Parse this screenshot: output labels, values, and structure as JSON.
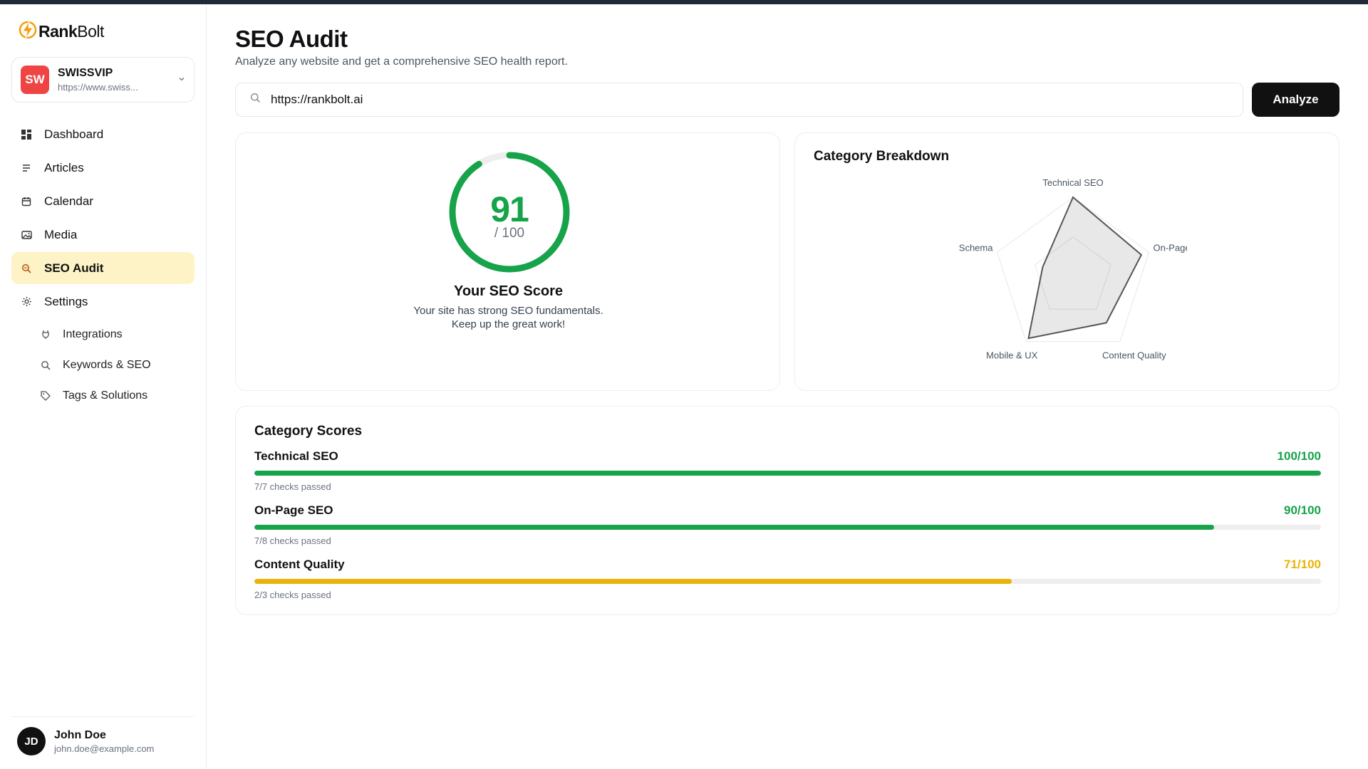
{
  "app": {
    "name_bold": "Rank",
    "name_light": "Bolt"
  },
  "workspace": {
    "initials": "SW",
    "name": "SWISSVIP",
    "url": "https://www.swiss..."
  },
  "nav": [
    {
      "label": "Dashboard",
      "icon": "dashboard-icon",
      "active": false
    },
    {
      "label": "Articles",
      "icon": "articles-icon",
      "active": false
    },
    {
      "label": "Calendar",
      "icon": "calendar-icon",
      "active": false
    },
    {
      "label": "Media",
      "icon": "media-icon",
      "active": false
    },
    {
      "label": "SEO Audit",
      "icon": "seo-audit-icon",
      "active": true
    },
    {
      "label": "Settings",
      "icon": "settings-icon",
      "active": false
    }
  ],
  "settings_sub": [
    {
      "label": "Integrations",
      "icon": "plug-icon"
    },
    {
      "label": "Keywords & SEO",
      "icon": "search-icon"
    },
    {
      "label": "Tags & Solutions",
      "icon": "tag-icon"
    }
  ],
  "user": {
    "initials": "JD",
    "name": "John Doe",
    "email": "john.doe@example.com"
  },
  "page": {
    "title": "SEO Audit",
    "subtitle": "Analyze any website and get a comprehensive SEO health report."
  },
  "search": {
    "value": "https://rankbolt.ai",
    "button": "Analyze"
  },
  "score": {
    "value": "91",
    "max": "/ 100",
    "fraction": 0.91,
    "title": "Your SEO Score",
    "desc_line1": "Your site has strong SEO fundamentals.",
    "desc_line2": "Keep up the great work!"
  },
  "breakdown": {
    "title": "Category Breakdown",
    "chart_data": {
      "type": "radar",
      "axes": [
        "Technical SEO",
        "On-Page SEO",
        "Content Quality",
        "Mobile & UX",
        "Structured Data & Schema"
      ],
      "axis_labels_visible": [
        "Technical SEO",
        "On-Page S",
        "Content Quality",
        "Mobile & UX",
        "ıl & Schema"
      ],
      "values": [
        100,
        90,
        71,
        95,
        40
      ],
      "range": [
        0,
        100
      ]
    }
  },
  "category_scores": {
    "title": "Category Scores",
    "rows": [
      {
        "name": "Technical SEO",
        "score": "100/100",
        "value": 100,
        "checks": "7/7 checks passed",
        "color": "#16a34a"
      },
      {
        "name": "On-Page SEO",
        "score": "90/100",
        "value": 90,
        "checks": "7/8 checks passed",
        "color": "#16a34a"
      },
      {
        "name": "Content Quality",
        "score": "71/100",
        "value": 71,
        "checks": "2/3 checks passed",
        "color": "#eab308"
      }
    ]
  },
  "colors": {
    "accent": "#fef3c7",
    "good": "#16a34a",
    "warn": "#eab308",
    "danger": "#ef4444"
  }
}
